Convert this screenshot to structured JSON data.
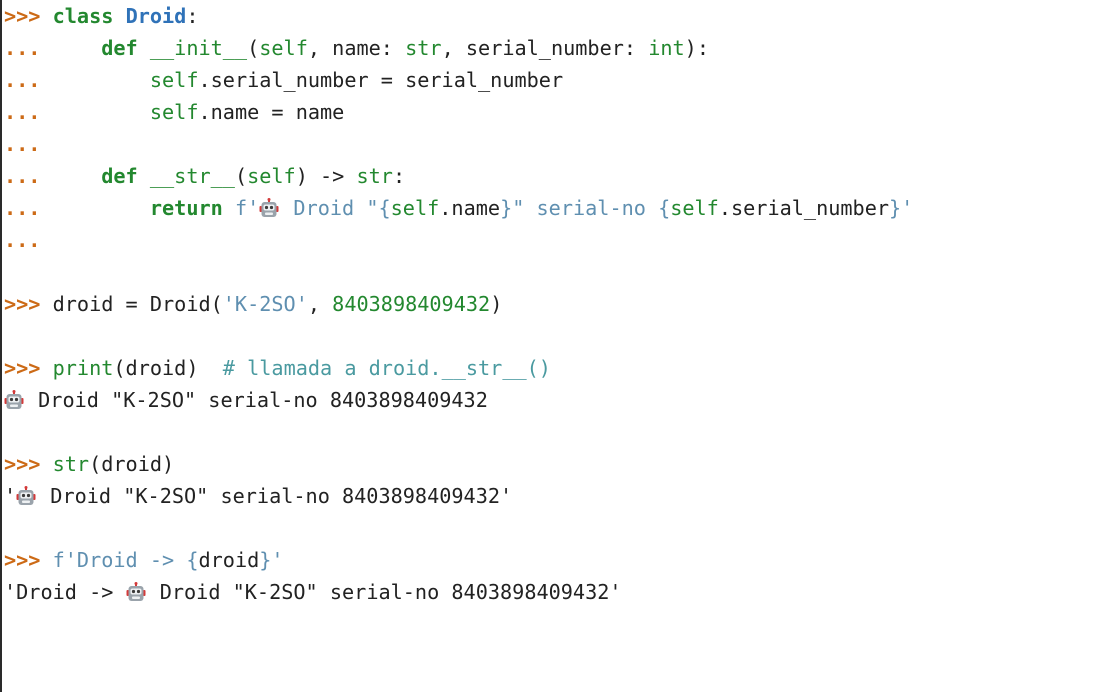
{
  "colors": {
    "prompt": "#cc6a16",
    "keyword": "#23882f",
    "classname": "#2f72b8",
    "builtin": "#23882f",
    "number": "#23882f",
    "string": "#5f8fb0",
    "comment": "#4a9aa0",
    "text": "#222222",
    "robot_head": "#9aa3ab",
    "robot_ears": "#d33a3a",
    "robot_eyes": "#3a3a3a"
  },
  "lines": [
    [
      {
        "t": "prompt",
        "v": ">>> "
      },
      {
        "t": "keyword",
        "v": "class"
      },
      {
        "t": "text",
        "v": " "
      },
      {
        "t": "classname",
        "v": "Droid"
      },
      {
        "t": "text",
        "v": ":"
      }
    ],
    [
      {
        "t": "prompt",
        "v": "...     "
      },
      {
        "t": "keyword",
        "v": "def"
      },
      {
        "t": "text",
        "v": " "
      },
      {
        "t": "builtin",
        "v": "__init__"
      },
      {
        "t": "text",
        "v": "("
      },
      {
        "t": "builtin",
        "v": "self"
      },
      {
        "t": "text",
        "v": ", name: "
      },
      {
        "t": "builtin",
        "v": "str"
      },
      {
        "t": "text",
        "v": ", serial_number: "
      },
      {
        "t": "builtin",
        "v": "int"
      },
      {
        "t": "text",
        "v": "):"
      }
    ],
    [
      {
        "t": "prompt",
        "v": "...         "
      },
      {
        "t": "builtin",
        "v": "self"
      },
      {
        "t": "text",
        "v": ".serial_number = serial_number"
      }
    ],
    [
      {
        "t": "prompt",
        "v": "...         "
      },
      {
        "t": "builtin",
        "v": "self"
      },
      {
        "t": "text",
        "v": ".name = name"
      }
    ],
    [
      {
        "t": "prompt",
        "v": "..."
      }
    ],
    [
      {
        "t": "prompt",
        "v": "...     "
      },
      {
        "t": "keyword",
        "v": "def"
      },
      {
        "t": "text",
        "v": " "
      },
      {
        "t": "builtin",
        "v": "__str__"
      },
      {
        "t": "text",
        "v": "("
      },
      {
        "t": "builtin",
        "v": "self"
      },
      {
        "t": "text",
        "v": ") -> "
      },
      {
        "t": "builtin",
        "v": "str"
      },
      {
        "t": "text",
        "v": ":"
      }
    ],
    [
      {
        "t": "prompt",
        "v": "...         "
      },
      {
        "t": "keyword",
        "v": "return"
      },
      {
        "t": "text",
        "v": " "
      },
      {
        "t": "string",
        "v": "f'"
      },
      {
        "t": "robot",
        "v": "robot-icon"
      },
      {
        "t": "string",
        "v": " Droid \"{"
      },
      {
        "t": "builtin",
        "v": "self"
      },
      {
        "t": "text",
        "v": ".name"
      },
      {
        "t": "string",
        "v": "}\" serial-no {"
      },
      {
        "t": "builtin",
        "v": "self"
      },
      {
        "t": "text",
        "v": ".serial_number"
      },
      {
        "t": "string",
        "v": "}'"
      }
    ],
    [
      {
        "t": "prompt",
        "v": "..."
      }
    ],
    [],
    [
      {
        "t": "prompt",
        "v": ">>> "
      },
      {
        "t": "text",
        "v": "droid = Droid("
      },
      {
        "t": "string",
        "v": "'K-2SO'"
      },
      {
        "t": "text",
        "v": ", "
      },
      {
        "t": "number",
        "v": "8403898409432"
      },
      {
        "t": "text",
        "v": ")"
      }
    ],
    [],
    [
      {
        "t": "prompt",
        "v": ">>> "
      },
      {
        "t": "builtin",
        "v": "print"
      },
      {
        "t": "text",
        "v": "(droid)  "
      },
      {
        "t": "comment",
        "v": "# llamada a droid.__str__()"
      }
    ],
    [
      {
        "t": "robot",
        "v": "robot-icon"
      },
      {
        "t": "output",
        "v": " Droid \"K-2SO\" serial-no 8403898409432"
      }
    ],
    [],
    [
      {
        "t": "prompt",
        "v": ">>> "
      },
      {
        "t": "builtin",
        "v": "str"
      },
      {
        "t": "text",
        "v": "(droid)"
      }
    ],
    [
      {
        "t": "output",
        "v": "'"
      },
      {
        "t": "robot",
        "v": "robot-icon"
      },
      {
        "t": "output",
        "v": " Droid \"K-2SO\" serial-no 8403898409432'"
      }
    ],
    [],
    [
      {
        "t": "prompt",
        "v": ">>> "
      },
      {
        "t": "string",
        "v": "f'Droid -> {"
      },
      {
        "t": "text",
        "v": "droid"
      },
      {
        "t": "string",
        "v": "}'"
      }
    ],
    [
      {
        "t": "output",
        "v": "'Droid -> "
      },
      {
        "t": "robot",
        "v": "robot-icon"
      },
      {
        "t": "output",
        "v": " Droid \"K-2SO\" serial-no 8403898409432'"
      }
    ]
  ]
}
